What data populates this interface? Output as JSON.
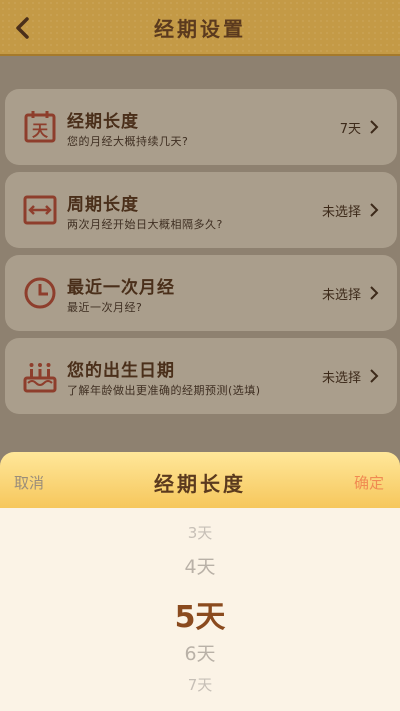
{
  "header": {
    "title": "经期设置"
  },
  "cards": [
    {
      "title": "经期长度",
      "subtitle": "您的月经大概持续几天?",
      "value": "7天",
      "icon": "calendar-icon"
    },
    {
      "title": "周期长度",
      "subtitle": "两次月经开始日大概相隔多久?",
      "value": "未选择",
      "icon": "cycle-range-icon"
    },
    {
      "title": "最近一次月经",
      "subtitle": "最近一次月经?",
      "value": "未选择",
      "icon": "clock-icon"
    },
    {
      "title": "您的出生日期",
      "subtitle": "了解年龄做出更准确的经期预测(选填)",
      "value": "未选择",
      "icon": "birthday-cake-icon"
    }
  ],
  "sheet": {
    "cancel": "取消",
    "title": "经期长度",
    "confirm": "确定",
    "options": [
      "3天",
      "4天",
      "5天",
      "6天",
      "7天"
    ],
    "selected": "5天"
  },
  "colors": {
    "accent": "#c0504d",
    "header": "#c49a46",
    "confirm": "#f08a52"
  }
}
